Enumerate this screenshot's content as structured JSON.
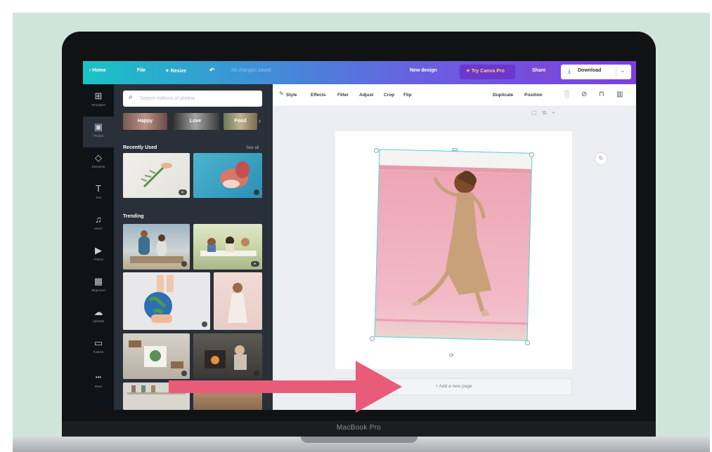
{
  "device": {
    "brand_label": "MacBook Pro"
  },
  "topbar": {
    "home": "‹ Home",
    "file": "File",
    "resize": "✦ Resize",
    "undo_icon": "undo-icon",
    "saved_status": "All changes saved",
    "design_title": "New design",
    "try_pro": "✦ Try Canva Pro",
    "share": "Share",
    "download": "Download"
  },
  "rail": {
    "items": [
      {
        "label": "Templates",
        "icon": "templates-icon",
        "glyph": "⊞"
      },
      {
        "label": "Photos",
        "icon": "photos-icon",
        "glyph": "▣"
      },
      {
        "label": "Elements",
        "icon": "elements-icon",
        "glyph": "◇"
      },
      {
        "label": "Text",
        "icon": "text-icon",
        "glyph": "T"
      },
      {
        "label": "Music",
        "icon": "music-icon",
        "glyph": "♫"
      },
      {
        "label": "Videos",
        "icon": "videos-icon",
        "glyph": "▶"
      },
      {
        "label": "Bkground",
        "icon": "background-icon",
        "glyph": "▦"
      },
      {
        "label": "Uploads",
        "icon": "uploads-icon",
        "glyph": "☁"
      },
      {
        "label": "Folders",
        "icon": "folders-icon",
        "glyph": "▭"
      },
      {
        "label": "More",
        "icon": "more-icon",
        "glyph": "•••"
      }
    ]
  },
  "panel": {
    "search_placeholder": "Search millions of photos",
    "chips": [
      "Happy",
      "Love",
      "Food"
    ],
    "recently_used_title": "Recently Used",
    "see_all": "See all",
    "trending_title": "Trending"
  },
  "toolbar": {
    "style": "Style",
    "effects": "Effects",
    "filter": "Filter",
    "adjust": "Adjust",
    "crop": "Crop",
    "flip": "Flip",
    "duplicate": "Duplicate",
    "position": "Position"
  },
  "canvas": {
    "add_page": "+ Add a new page"
  },
  "colors": {
    "topbar_start": "#19c3c5",
    "topbar_end": "#7c3fe0",
    "rail_bg": "#0e1318",
    "panel_bg": "#293039",
    "selection": "#51cfd2",
    "callout_arrow": "#e85c7a",
    "mint_background": "#cfe5dc"
  }
}
